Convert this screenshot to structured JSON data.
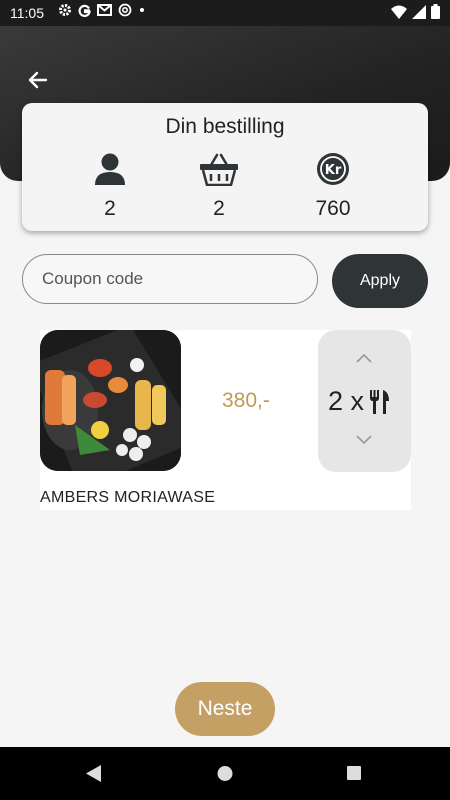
{
  "status_bar": {
    "time": "11:05"
  },
  "order_summary": {
    "title": "Din bestilling",
    "guests": "2",
    "items": "2",
    "total": "760"
  },
  "coupon": {
    "placeholder": "Coupon code",
    "apply_label": "Apply"
  },
  "cart_item": {
    "name": "AMBERS MORIAWASE",
    "price": "380,-",
    "quantity": "2 x"
  },
  "footer": {
    "next_label": "Neste"
  },
  "colors": {
    "accent": "#c5a065",
    "dark": "#2f3537",
    "price": "#c39a55"
  }
}
